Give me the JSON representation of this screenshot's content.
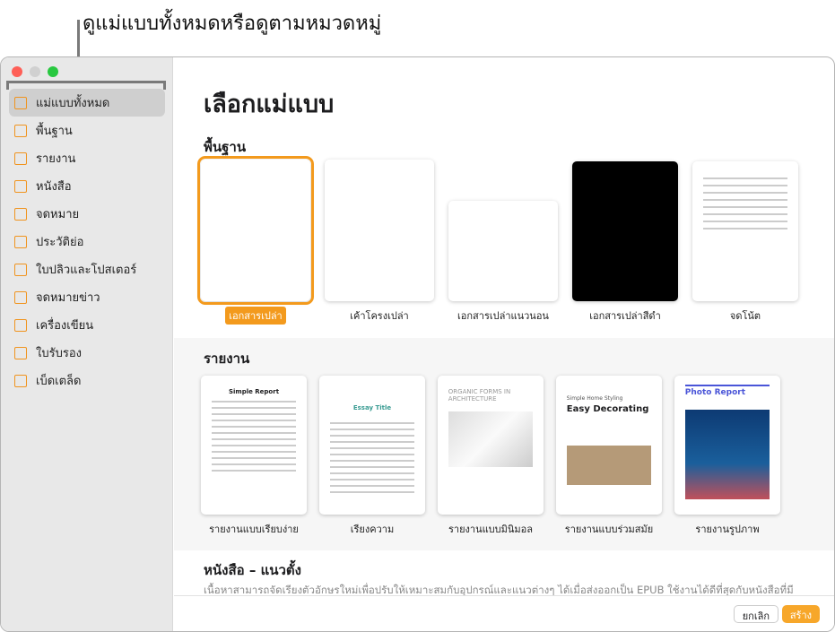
{
  "callout": "ดูแม่แบบทั้งหมดหรือดูตามหมวดหมู่",
  "window_controls": {
    "close": "#fe5f57",
    "minimize": "#d0d0d0",
    "zoom": "#28c840"
  },
  "sidebar": {
    "items": [
      {
        "label": "แม่แบบทั้งหมด",
        "icon": "grid-icon",
        "selected": true
      },
      {
        "label": "พื้นฐาน",
        "icon": "document-icon"
      },
      {
        "label": "รายงาน",
        "icon": "graduation-cap-icon"
      },
      {
        "label": "หนังสือ",
        "icon": "book-icon"
      },
      {
        "label": "จดหมาย",
        "icon": "letter-icon"
      },
      {
        "label": "ประวัติย่อ",
        "icon": "resume-icon"
      },
      {
        "label": "ใบปลิวและโปสเตอร์",
        "icon": "poster-icon"
      },
      {
        "label": "จดหมายข่าว",
        "icon": "newsletter-icon"
      },
      {
        "label": "เครื่องเขียน",
        "icon": "stamp-icon"
      },
      {
        "label": "ใบรับรอง",
        "icon": "ribbon-icon"
      },
      {
        "label": "เบ็ดเตล็ด",
        "icon": "archive-icon"
      }
    ]
  },
  "main": {
    "title": "เลือกแม่แบบ",
    "sections": [
      {
        "title": "พื้นฐาน",
        "templates": [
          {
            "label": "เอกสารเปล่า",
            "selected": true
          },
          {
            "label": "เค้าโครงเปล่า"
          },
          {
            "label": "เอกสารเปล่าแนวนอน"
          },
          {
            "label": "เอกสารเปล่าสีดำ"
          },
          {
            "label": "จดโน้ต"
          }
        ]
      },
      {
        "title": "รายงาน",
        "templates": [
          {
            "label": "รายงานแบบเรียบง่าย",
            "thumb_title": "Simple Report"
          },
          {
            "label": "เรียงความ",
            "thumb_title": "Essay Title"
          },
          {
            "label": "รายงานแบบมินิมอล",
            "thumb_title": "ORGANIC FORMS IN ARCHITECTURE"
          },
          {
            "label": "รายงานแบบร่วมสมัย",
            "thumb_title": "Easy Decorating",
            "thumb_subtitle": "Simple Home Styling"
          },
          {
            "label": "รายงานรูปภาพ",
            "thumb_title": "Photo Report"
          }
        ]
      },
      {
        "title": "หนังสือ – แนวตั้ง",
        "description": "เนื้อหาสามารถจัดเรียงตัวอักษรใหม่เพื่อปรับให้เหมาะสมกับอุปกรณ์และแนวต่างๆ ได้เมื่อส่งออกเป็น EPUB ใช้งานได้ดีที่สุดกับหนังสือที่มี"
      }
    ]
  },
  "footer": {
    "cancel": "ยกเลิก",
    "create": "สร้าง"
  },
  "accent": "#f39a1d"
}
